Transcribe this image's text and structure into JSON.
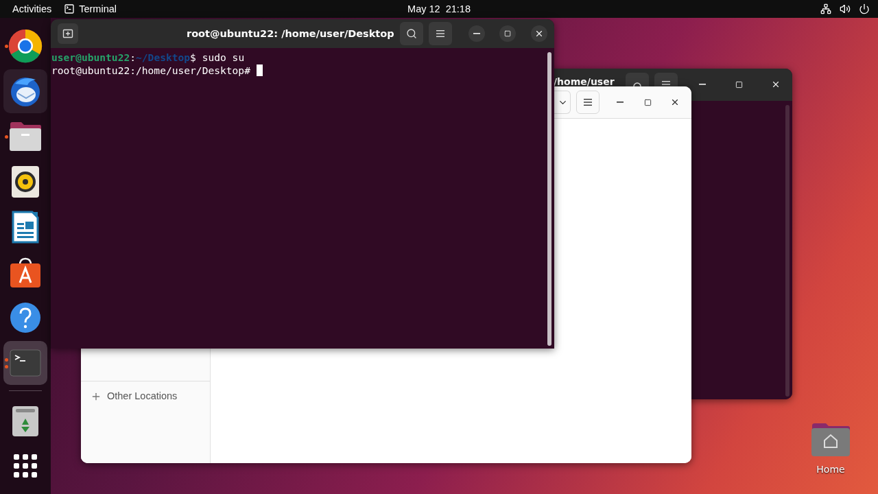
{
  "top_bar": {
    "activities": "Activities",
    "app": "Terminal",
    "clock": "May 12  21:18"
  },
  "dock": {
    "items": [
      {
        "kind": "browser",
        "running": true,
        "multiple_windows": false,
        "selected": false,
        "hovered": false
      },
      {
        "kind": "mail",
        "running": false,
        "selected": false,
        "hovered": true
      },
      {
        "kind": "files",
        "running": true,
        "multiple_windows": false,
        "selected": false,
        "hovered": false
      },
      {
        "kind": "music",
        "running": false,
        "selected": false,
        "hovered": false
      },
      {
        "kind": "writer",
        "running": false,
        "selected": false,
        "hovered": false
      },
      {
        "kind": "store",
        "running": false,
        "selected": false,
        "hovered": false
      },
      {
        "kind": "help",
        "running": false,
        "selected": false,
        "hovered": false
      },
      {
        "kind": "terminal",
        "running": true,
        "multiple_windows": true,
        "selected": true,
        "hovered": false
      },
      {
        "kind": "trash",
        "running": false,
        "selected": false,
        "hovered": false
      }
    ]
  },
  "back_terminal": {
    "title": "/home/user"
  },
  "files_window": {
    "sidebar": [
      {
        "label": "Other Locations"
      }
    ]
  },
  "terminal": {
    "title": "root@ubuntu22: /home/user/Desktop",
    "lines": [
      {
        "parts": [
          {
            "kind": "user",
            "text": "user@ubuntu22"
          },
          {
            "kind": "plain",
            "text": ":"
          },
          {
            "kind": "path",
            "text": "~/Desktop"
          },
          {
            "kind": "plain",
            "text": "$ sudo su"
          }
        ],
        "cursor": false
      },
      {
        "parts": [
          {
            "kind": "plain",
            "text": "root@ubuntu22:/home/user/Desktop# "
          }
        ],
        "cursor": true
      }
    ]
  },
  "desktop_icons": [
    {
      "label": "Home"
    }
  ]
}
